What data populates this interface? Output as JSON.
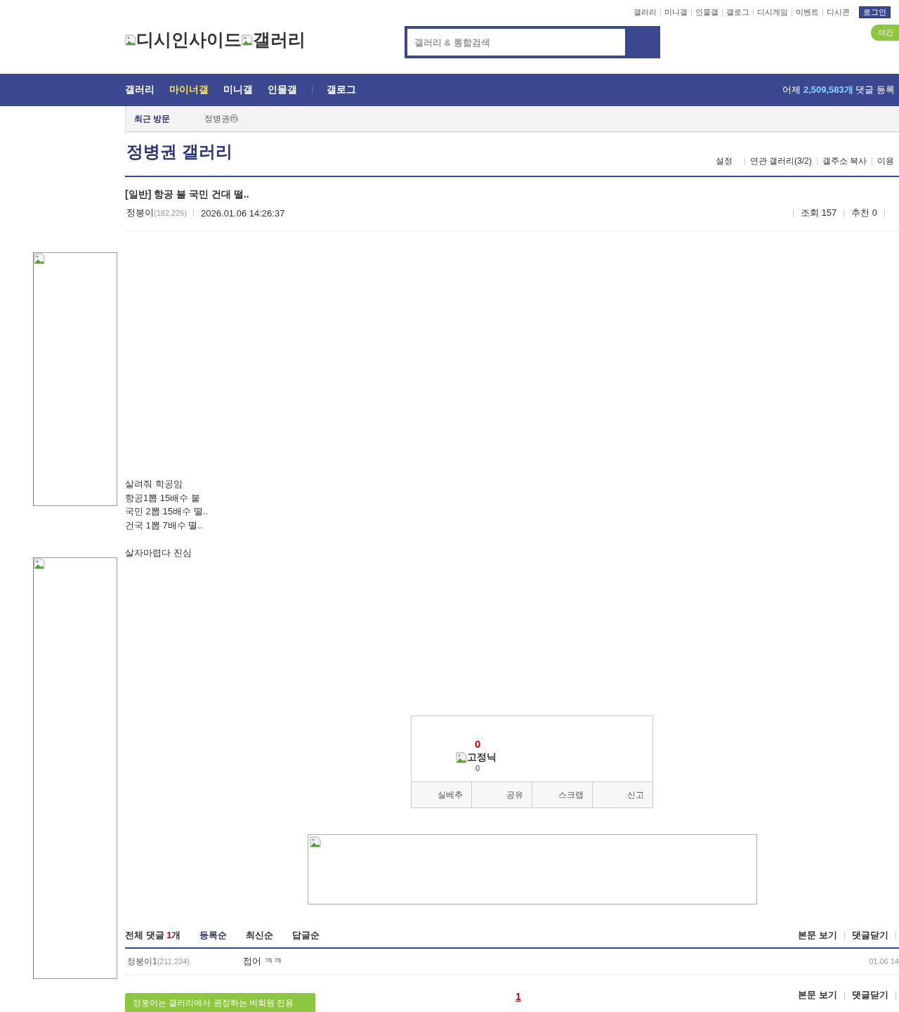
{
  "top_links": [
    "갤러리",
    "미니갤",
    "인물갤",
    "갤로그",
    "디시게임",
    "이벤트",
    "디시콘"
  ],
  "login_button": "로그인",
  "night_mode_button": "야간",
  "logo": {
    "site": "디시인사이드",
    "section": "갤러리"
  },
  "search": {
    "placeholder": "갤러리 & 통합검색"
  },
  "nav": {
    "items": [
      {
        "label": "갤러리",
        "selected": false
      },
      {
        "label": "마이너갤",
        "selected": true
      },
      {
        "label": "미니갤",
        "selected": false
      },
      {
        "label": "인물갤",
        "selected": false
      },
      {
        "label": "갤로그",
        "selected": false
      }
    ],
    "stat_prefix": "어제",
    "stat_count": "2,509,583개",
    "stat_suffix": "댓글 등록"
  },
  "recent": {
    "label": "최근 방문",
    "items": [
      {
        "name": "정병권",
        "badge": "ⓜ"
      }
    ]
  },
  "gallery": {
    "title": "정병권 갤러리",
    "links": [
      "설정",
      "연관 갤러리(3/2)",
      "갤주소 복사",
      "이용"
    ]
  },
  "post": {
    "title": "[일반] 항공 불 국민 건대 떨..",
    "author": "정붕이",
    "ip": "(182.226)",
    "date": "2026.01.06 14:26:37",
    "views": "조회 157",
    "recommends": "추천 0",
    "body": [
      [
        "살려줘 학공임",
        "항공1뽑 15배수 붙",
        "국민 2뽑 15배수 떨..",
        "건국 1뽑 7배수 떨.."
      ],
      [
        "살자마렵다 진심"
      ]
    ]
  },
  "recommend_box": {
    "up_count": "0",
    "fixed_nick_label": "고정닉",
    "fixed_count": "0",
    "actions": [
      "실베추",
      "공유",
      "스크랩",
      "신고"
    ]
  },
  "comments": {
    "title": "전체 댓글",
    "count": "1",
    "unit": "개",
    "sorts": [
      {
        "label": "등록순",
        "selected": true
      },
      {
        "label": "최신순",
        "selected": false
      },
      {
        "label": "답글순",
        "selected": false
      }
    ],
    "links": [
      "본문 보기",
      "댓글닫기"
    ],
    "footer_links": [
      "본문 보기",
      "댓글닫기"
    ],
    "items": [
      {
        "author": "정붕이1",
        "ip": "(211.234)",
        "text": "접어 ㅋㅋ",
        "date": "01.06 14"
      }
    ],
    "pages": [
      {
        "label": "1",
        "selected": true
      }
    ],
    "notice": "정붕이는 갤러리에서 권장하는 비회원 전용"
  }
}
